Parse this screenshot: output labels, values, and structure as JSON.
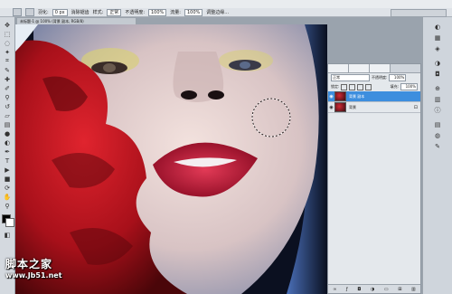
{
  "options_bar": {
    "feather_label": "羽化:",
    "feather_value": "0 px",
    "antialias_label": "消除锯齿",
    "style_label": "样式:",
    "style_value": "正常",
    "opacity_label": "不透明度:",
    "opacity_value": "100%",
    "flow_label": "流量:",
    "flow_value": "100%",
    "refine_label": "调整边缘..."
  },
  "document": {
    "tab_title": "未标题-1 @ 100% (背景 副本, RGB/8)"
  },
  "layers_panel": {
    "blend_mode": "正常",
    "opacity_label": "不透明度:",
    "opacity_value": "100%",
    "lock_label": "锁定:",
    "fill_label": "填充:",
    "fill_value": "100%",
    "layers": [
      {
        "name": "背景 副本",
        "selected": true
      },
      {
        "name": "背景",
        "selected": false,
        "locked": true
      }
    ],
    "bottom_icons": [
      "link-icon",
      "fx-icon",
      "mask-icon",
      "adjustment-icon",
      "folder-icon",
      "new-layer-icon",
      "trash-icon"
    ]
  },
  "watermark": {
    "title": "脚本之家",
    "url": "www.Jb51.net"
  }
}
